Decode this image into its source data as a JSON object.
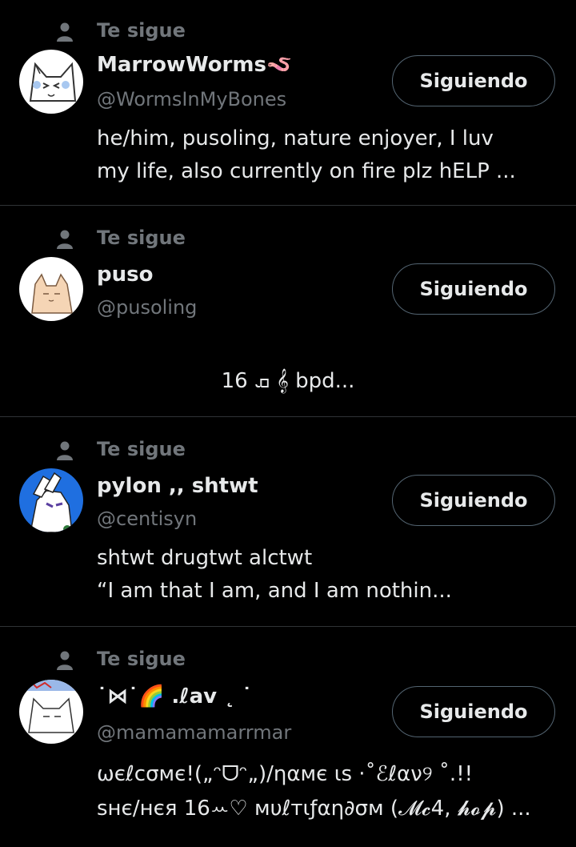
{
  "follows_label": "Te sigue",
  "button_label": "Siguiendo",
  "users": [
    {
      "display_name": "MarrowWorms🪱",
      "handle": "@WormsInMyBones",
      "bio_lines": [
        "he/him, pusoling, nature enjoyer, I luv",
        "my life, also currently on fire plz hELP ..."
      ]
    },
    {
      "display_name": "puso",
      "handle": "@pusoling",
      "bio_lines": [
        "ܩ 16   𝄞   bpd..."
      ]
    },
    {
      "display_name": "pylon ,, shtwt",
      "handle": "@centisyn",
      "bio_lines": [
        "shtwt drugtwt alctwt",
        "“I am that I am, and I am nothin..."
      ]
    },
    {
      "display_name": "˙⋈˙🌈 .ℓav ˛ ˙",
      "handle": "@mamamamarrmar",
      "bio_lines": [
        "ωєℓcσмє!(„ᵔᗜᵔ„)/ηαмє ιѕ ·˚ℰℓαν୨ ˚.!!",
        "ѕнє/нєя 16ꕀ♡ мυℓтιƒαη∂σм (𝓜𝓬4, 𝓱𝓸𝓹) ..."
      ]
    }
  ],
  "colors": {
    "background": "#000000",
    "primary_text": "#e7e9ea",
    "secondary_text": "#71767b",
    "divider": "#2f3336",
    "button_border": "#536471"
  }
}
